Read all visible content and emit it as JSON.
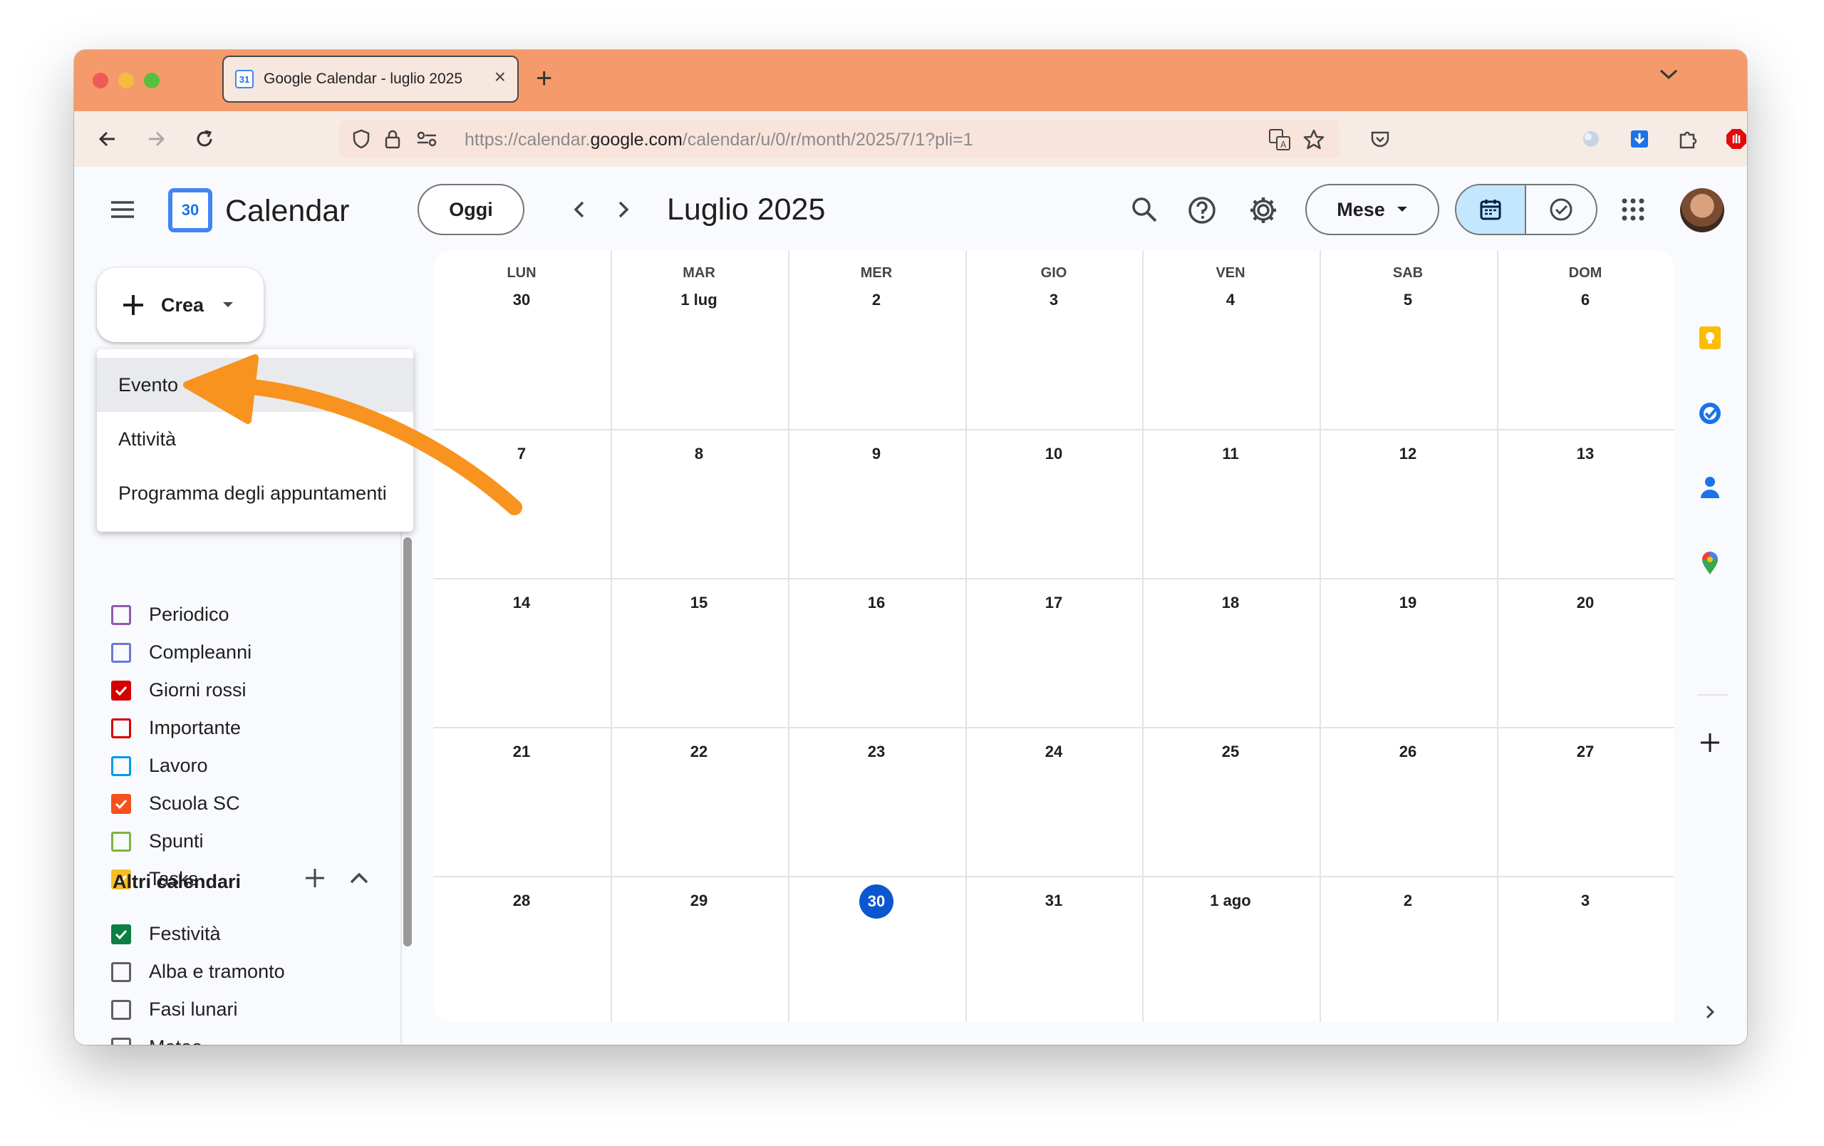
{
  "browser": {
    "tab_title": "Google Calendar - luglio 2025",
    "tab_favicon_text": "31",
    "url_prefix": "https://calendar.",
    "url_domain": "google.com",
    "url_path": "/calendar/u/0/r/month/2025/7/1?pli=1"
  },
  "app": {
    "name": "Calendar",
    "logo_text": "30",
    "today_button": "Oggi",
    "month_title": "Luglio 2025",
    "view_button": "Mese"
  },
  "create": {
    "label": "Crea",
    "menu": [
      "Evento",
      "Attività",
      "Programma degli appuntamenti"
    ]
  },
  "my_calendars": [
    {
      "name": "Periodico",
      "checked": false,
      "color": "#8e5bb0"
    },
    {
      "name": "Compleanni",
      "checked": false,
      "color": "#6b78d6"
    },
    {
      "name": "Giorni rossi",
      "checked": true,
      "color": "#d50000"
    },
    {
      "name": "Importante",
      "checked": false,
      "color": "#d50000"
    },
    {
      "name": "Lavoro",
      "checked": false,
      "color": "#039be5"
    },
    {
      "name": "Scuola SC",
      "checked": true,
      "color": "#f4511e"
    },
    {
      "name": "Spunti",
      "checked": false,
      "color": "#7cb342"
    },
    {
      "name": "Tasks",
      "checked": true,
      "color": "#f6bf26"
    }
  ],
  "other_calendars": {
    "title": "Altri calendari",
    "items": [
      {
        "name": "Festività",
        "checked": true,
        "color": "#0b8043"
      },
      {
        "name": "Alba e tramonto",
        "checked": false,
        "color": "#616161"
      },
      {
        "name": "Fasi lunari",
        "checked": false,
        "color": "#616161"
      },
      {
        "name": "Meteo",
        "checked": false,
        "color": "#616161"
      }
    ]
  },
  "month": {
    "weekdays": [
      "LUN",
      "MAR",
      "MER",
      "GIO",
      "VEN",
      "SAB",
      "DOM"
    ],
    "weeks": [
      [
        "30",
        "1 lug",
        "2",
        "3",
        "4",
        "5",
        "6"
      ],
      [
        "7",
        "8",
        "9",
        "10",
        "11",
        "12",
        "13"
      ],
      [
        "14",
        "15",
        "16",
        "17",
        "18",
        "19",
        "20"
      ],
      [
        "21",
        "22",
        "23",
        "24",
        "25",
        "26",
        "27"
      ],
      [
        "28",
        "29",
        "30",
        "31",
        "1 ago",
        "2",
        "3"
      ]
    ],
    "today": {
      "week": 4,
      "day": 2
    }
  },
  "colors": {
    "tabbar": "#f49a6b",
    "accent": "#0b57d0",
    "arrow": "#f7931e"
  }
}
